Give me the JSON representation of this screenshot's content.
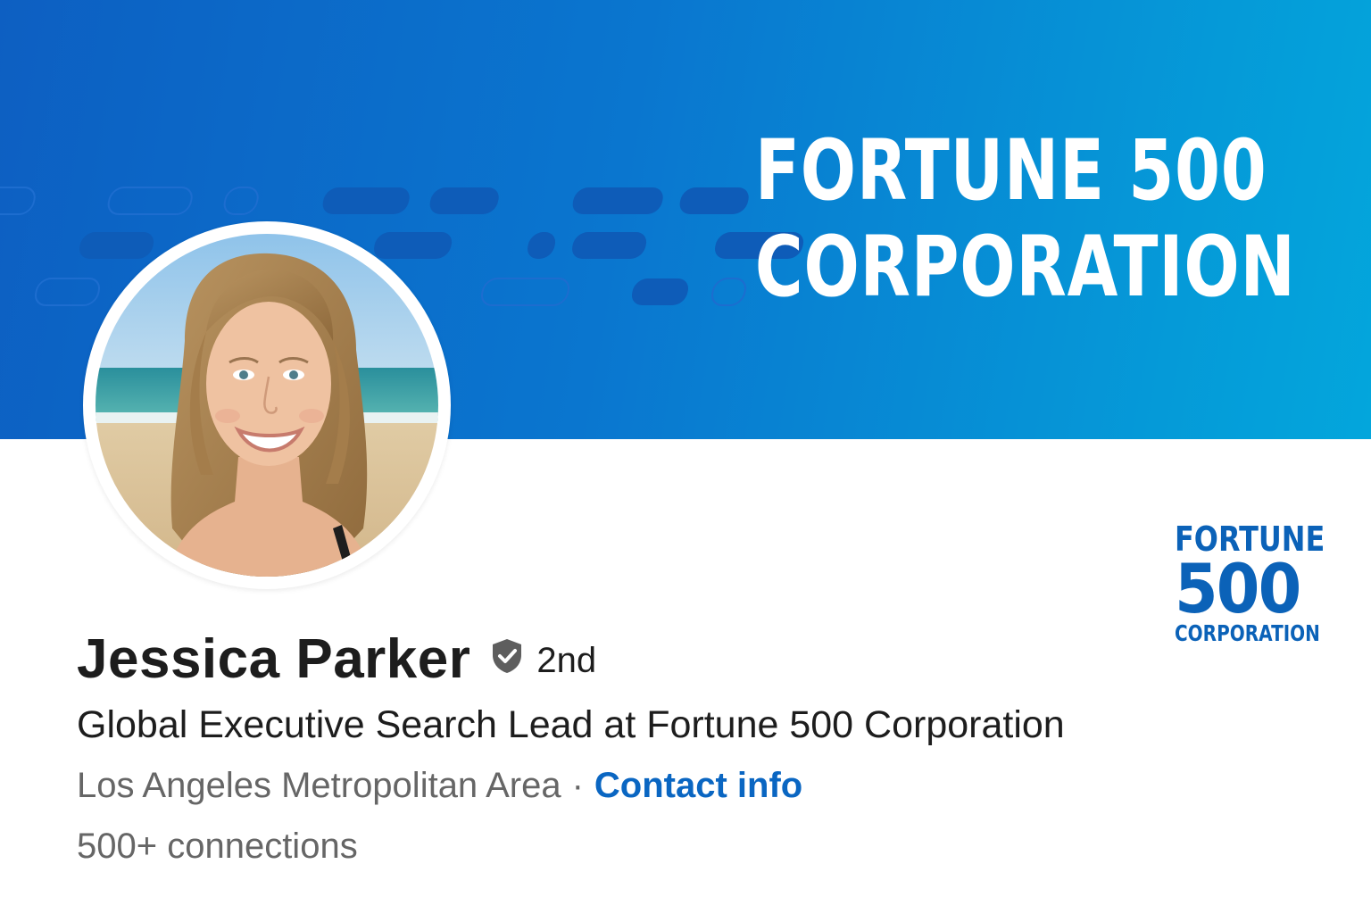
{
  "banner": {
    "title_line1": "FORTUNE 500",
    "title_line2": "CORPORATION"
  },
  "company_logo": {
    "line1": "FORTUNE",
    "line2": "500",
    "line3": "CORPORATION"
  },
  "profile": {
    "name": "Jessica Parker",
    "verified_icon": "verified-shield-icon",
    "degree": "2nd",
    "headline": "Global Executive Search Lead at Fortune 500 Corporation",
    "location": "Los Angeles Metropolitan Area",
    "separator": "·",
    "contact_label": "Contact info",
    "connections": "500+ connections"
  },
  "colors": {
    "banner_dark": "#0d5fc2",
    "banner_light": "#03a6dc",
    "link_blue": "#0a66c2",
    "logo_blue": "#0b62b8",
    "text_primary": "#1d1d1d",
    "text_secondary": "#666666"
  }
}
